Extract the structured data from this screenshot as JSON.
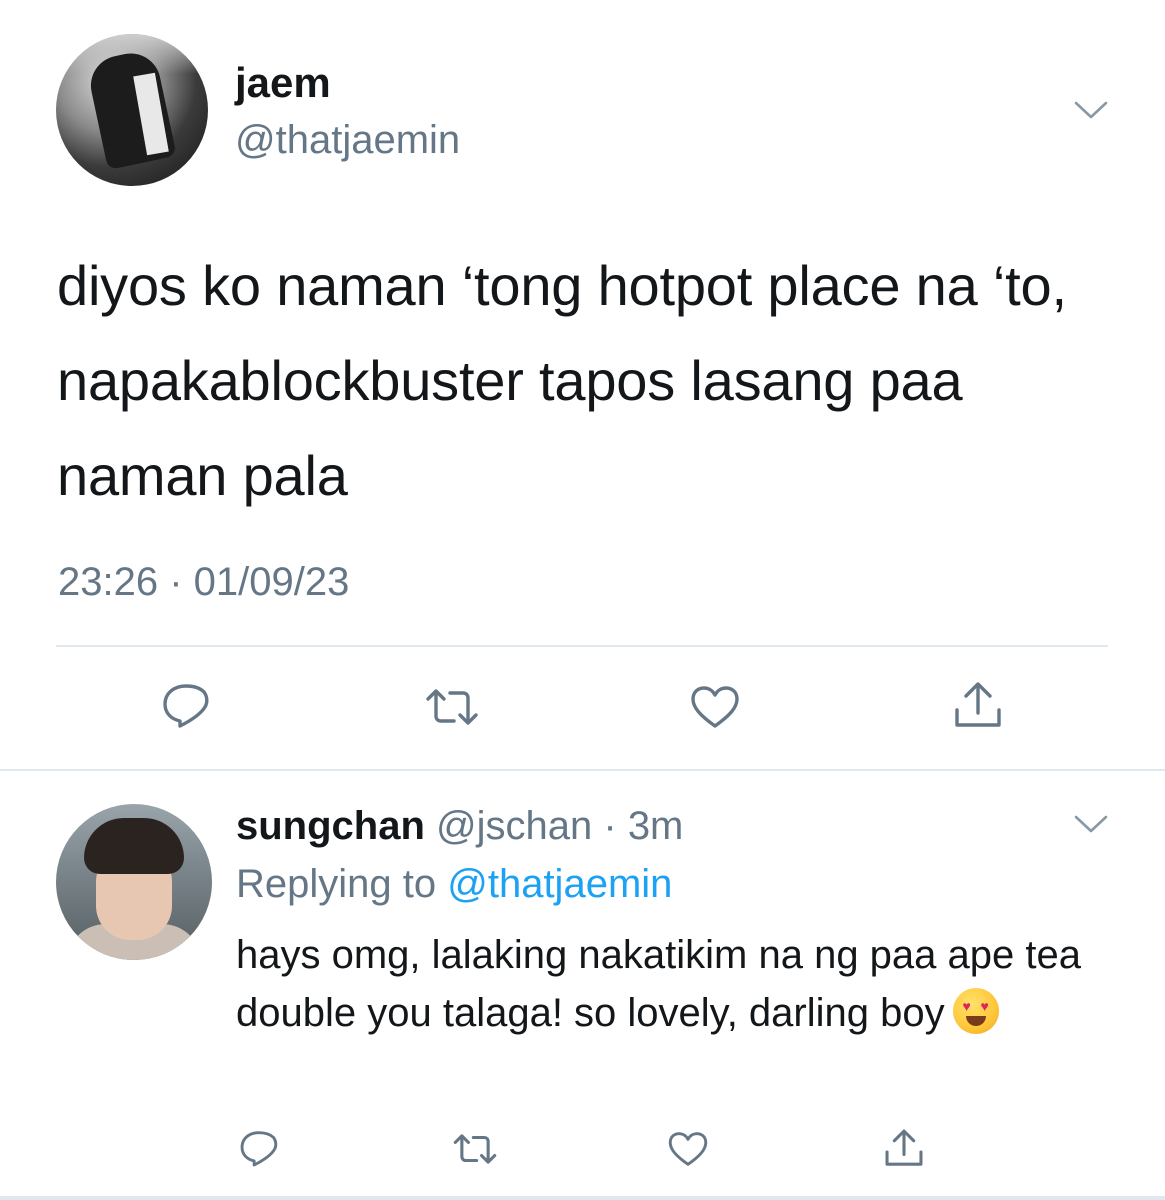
{
  "main_tweet": {
    "author_name": "jaem",
    "author_handle": "@thatjaemin",
    "text": "diyos ko naman ‘tong hotpot place na ‘to, napakablockbuster tapos lasang paa naman pala",
    "timestamp": "23:26 · 01/09/23"
  },
  "reply": {
    "author_name": "sungchan",
    "author_handle": "@jschan",
    "separator": " · ",
    "time": "3m",
    "replying_prefix": "Replying to ",
    "replying_mention": "@thatjaemin",
    "text": "hays omg, lalaking nakatikim na ng paa ape tea double you talaga! so lovely, darling boy",
    "emoji": "smiling-face-with-heart-eyes"
  },
  "icons": [
    "chevron-down-icon",
    "reply-icon",
    "retweet-icon",
    "like-icon",
    "share-icon"
  ],
  "colors": {
    "text_primary": "#14171a",
    "text_secondary": "#657786",
    "icon": "#657786",
    "link": "#1da1f2",
    "divider": "#e1e8ed"
  }
}
